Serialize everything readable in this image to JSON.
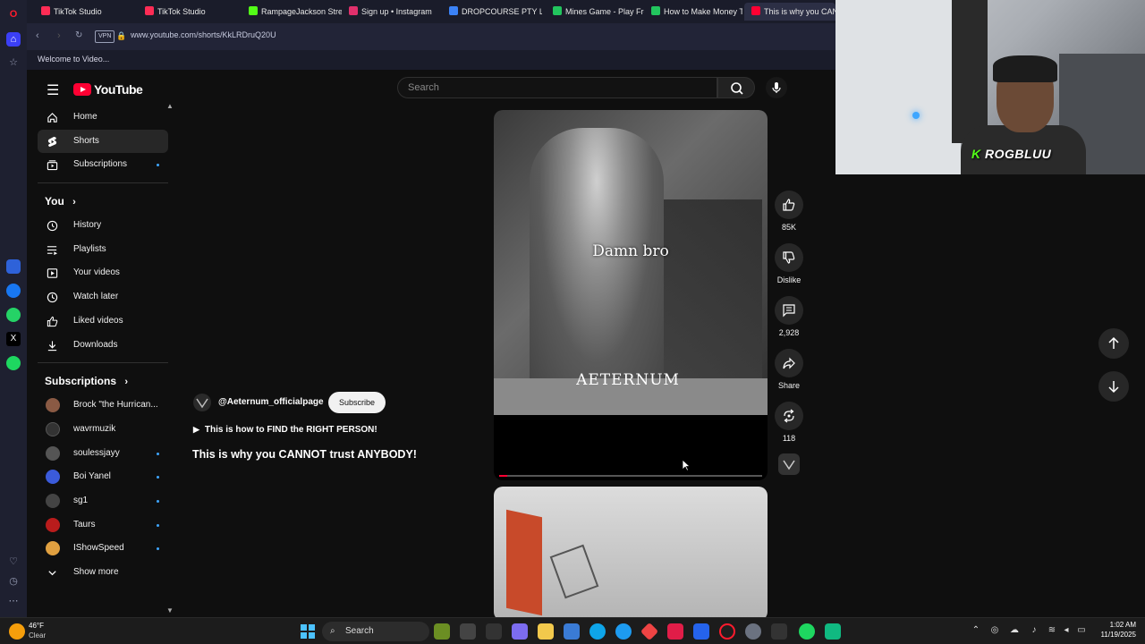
{
  "browser": {
    "tabs": [
      {
        "label": "TikTok Studio",
        "color": "#fe2c55"
      },
      {
        "label": "TikTok Studio",
        "color": "#fe2c55"
      },
      {
        "label": "RampageJackson Stream",
        "color": "#53fc18"
      },
      {
        "label": "Sign up • Instagram",
        "color": "#e1306c"
      },
      {
        "label": "DROPCOURSE PTY LTD",
        "color": "#3b82f6"
      },
      {
        "label": "Mines Game - Play Free S",
        "color": "#22c55e"
      },
      {
        "label": "How to Make Money Trad",
        "color": "#22c55e"
      },
      {
        "label": "This is why you CAN",
        "color": "#ff0033"
      }
    ],
    "vpn_label": "VPN",
    "url": "www.youtube.com/shorts/KkLRDruQ20U",
    "bookmark": "Welcome to Video..."
  },
  "youtube": {
    "logo_text": "YouTube",
    "search_placeholder": "Search",
    "sidebar": {
      "main": [
        {
          "label": "Home",
          "icon": "home-icon"
        },
        {
          "label": "Shorts",
          "icon": "shorts-icon",
          "active": true
        },
        {
          "label": "Subscriptions",
          "icon": "subscriptions-icon",
          "dot": true
        }
      ],
      "you_heading": "You",
      "you_items": [
        {
          "label": "History",
          "icon": "history-icon"
        },
        {
          "label": "Playlists",
          "icon": "playlists-icon"
        },
        {
          "label": "Your videos",
          "icon": "your-videos-icon"
        },
        {
          "label": "Watch later",
          "icon": "clock-icon"
        },
        {
          "label": "Liked videos",
          "icon": "thumbs-up-icon"
        },
        {
          "label": "Downloads",
          "icon": "download-icon"
        }
      ],
      "subscriptions_heading": "Subscriptions",
      "subscriptions": [
        {
          "label": "Brock \"the Hurrican...",
          "color": "#8a5a44",
          "dot": false
        },
        {
          "label": "wavrmuzik",
          "color": "#333333",
          "dot": false
        },
        {
          "label": "soulessjayy",
          "color": "#555555",
          "dot": true
        },
        {
          "label": "Boi Yanel",
          "color": "#3b5bdb",
          "dot": true
        },
        {
          "label": "sg1",
          "color": "#444444",
          "dot": true
        },
        {
          "label": "Taurs",
          "color": "#b91c1c",
          "dot": true
        },
        {
          "label": "IShowSpeed",
          "color": "#e0a040",
          "dot": true
        }
      ],
      "show_more": "Show more"
    },
    "short": {
      "channel": "@Aeternum_officialpage",
      "subscribe": "Subscribe",
      "playlist": "This is how to FIND the RIGHT PERSON!",
      "title": "This is why you CANNOT trust ANYBODY!",
      "caption": "Damn bro",
      "watermark": "AETERNUM",
      "progress": 0.03
    },
    "actions": {
      "likes": "85K",
      "dislike": "Dislike",
      "comments": "2,928",
      "share": "Share",
      "remix": "118"
    }
  },
  "webcam": {
    "name": "ROGBLUU",
    "logo": "K"
  },
  "taskbar": {
    "temperature": "46°F",
    "weather": "Clear",
    "search": "Search",
    "time": "1:02 AM",
    "date": "11/19/2025"
  }
}
